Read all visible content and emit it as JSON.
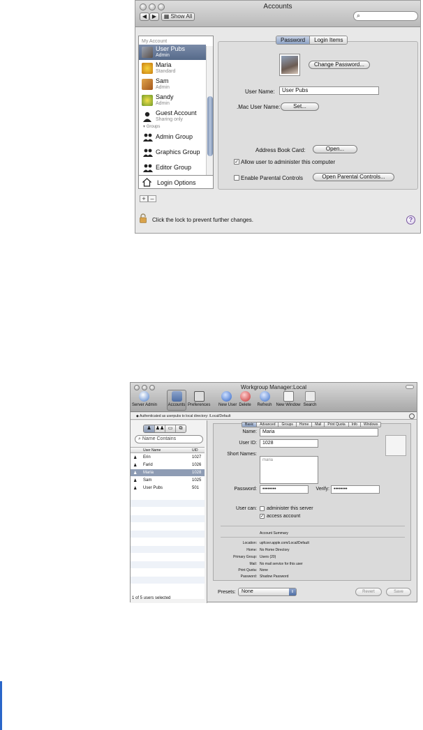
{
  "accounts_window": {
    "title": "Accounts",
    "show_all": "Show All",
    "search_placeholder": "",
    "sidebar": {
      "header": "My Account",
      "users": [
        {
          "name": "User Pubs",
          "role": "Admin",
          "selected": true
        },
        {
          "name": "Maria",
          "role": "Standard"
        },
        {
          "name": "Sam",
          "role": "Admin"
        },
        {
          "name": "Sandy",
          "role": "Admin"
        },
        {
          "name": "Guest Account",
          "role": "Sharing only"
        }
      ],
      "groups_header": "Groups",
      "groups": [
        "Admin Group",
        "Graphics Group",
        "Editor Group"
      ],
      "login_options": "Login Options",
      "add": "+",
      "remove": "–"
    },
    "tabs": [
      "Password",
      "Login Items"
    ],
    "change_password": "Change Password...",
    "user_name_label": "User Name:",
    "user_name_value": "User Pubs",
    "mac_user_name_label": ".Mac User Name:",
    "set_button": "Set...",
    "address_book_label": "Address Book Card:",
    "open_button": "Open...",
    "allow_admin": "Allow user to administer this computer",
    "enable_parental": "Enable Parental Controls",
    "open_parental": "Open Parental Controls...",
    "lock_text": "Click the lock to prevent further changes.",
    "help": "?"
  },
  "wgm_window": {
    "title": "Workgroup Manager:Local",
    "toolbar": [
      "Server Admin",
      "Accounts",
      "Preferences",
      "New User",
      "Delete",
      "Refresh",
      "New Window",
      "Search"
    ],
    "auth_bar": "Authenticated as userpubs to local directory: /Local/Default",
    "search_placeholder": "Name Contains",
    "table": {
      "col_name": "User Name",
      "col_uid": "UID",
      "rows": [
        {
          "name": "Erin",
          "uid": "1027"
        },
        {
          "name": "Farid",
          "uid": "1026"
        },
        {
          "name": "Maria",
          "uid": "1028",
          "selected": true
        },
        {
          "name": "Sam",
          "uid": "1025"
        },
        {
          "name": "User Pubs",
          "uid": "501"
        }
      ]
    },
    "status": "1 of 5 users selected",
    "tabs": [
      "Basic",
      "Advanced",
      "Groups",
      "Home",
      "Mail",
      "Print Quota",
      "Info",
      "Windows"
    ],
    "form": {
      "name_label": "Name:",
      "name_value": "Maria",
      "uid_label": "User ID:",
      "uid_value": "1028",
      "short_names_label": "Short Names:",
      "short_name_value": "maria",
      "password_label": "Password:",
      "password_value": "••••••••",
      "verify_label": "Verify:",
      "verify_value": "••••••••",
      "user_can_label": "User can:",
      "administer": "administer this server",
      "access": "access account"
    },
    "summary": {
      "title": "Account Summary",
      "rows": [
        {
          "label": "Location:",
          "value": "upfcsvr.apple.com/Local/Default"
        },
        {
          "label": "Home:",
          "value": "No Home Directory"
        },
        {
          "label": "Primary Group:",
          "value": "Users (20)"
        },
        {
          "label": "Mail:",
          "value": "No mail service for this user"
        },
        {
          "label": "Print Quota:",
          "value": "None"
        },
        {
          "label": "Password:",
          "value": "Shadow Password"
        }
      ]
    },
    "presets_label": "Presets:",
    "presets_value": "None",
    "revert": "Revert",
    "save": "Save"
  }
}
